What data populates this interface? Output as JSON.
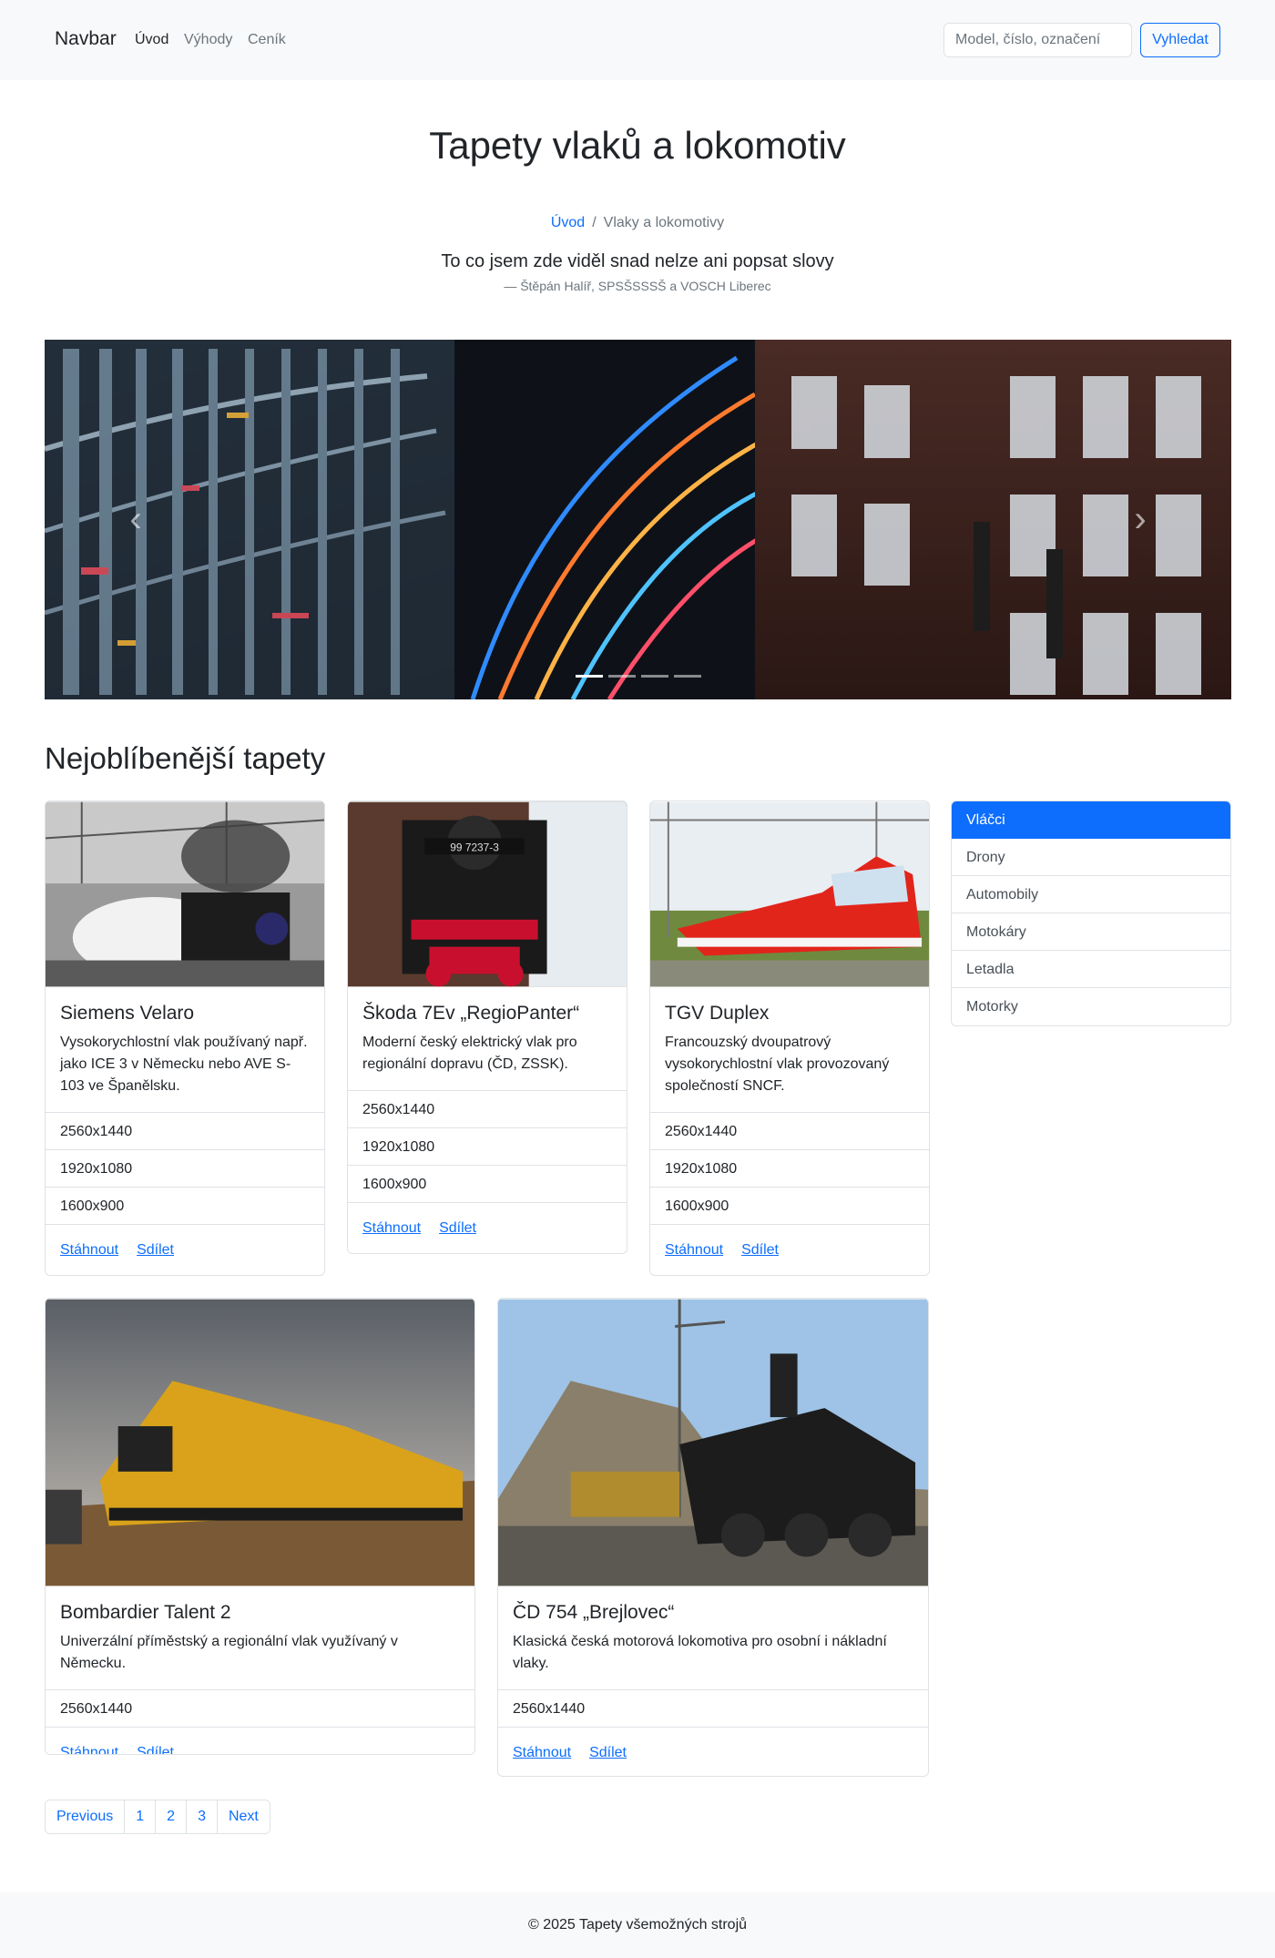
{
  "navbar": {
    "brand": "Navbar",
    "links": [
      "Úvod",
      "Výhody",
      "Ceník"
    ],
    "search": {
      "placeholder": "Model, číslo, označení",
      "button": "Vyhledat"
    }
  },
  "hero": {
    "title": "Tapety vlaků a lokomotiv",
    "breadcrumb": {
      "home": "Úvod",
      "separator": "/",
      "current": "Vlaky a lokomotivy"
    },
    "quote": "To co jsem zde viděl snad nelze ani popsat slovy",
    "quote_author": "— Štěpán Halíř, SPSŠSSSŠ a VOSCH Liberec"
  },
  "carousel": {
    "prev_icon": "chevron-left-icon",
    "next_icon": "chevron-right-icon",
    "slides_count": 4,
    "active_index": 0
  },
  "section": {
    "title": "Nejoblíbenější tapety"
  },
  "cards": [
    {
      "title": "Siemens Velaro",
      "text": "Vysokorychlostní vlak používaný např. jako ICE 3 v Německu nebo AVE S-103 ve Španělsku.",
      "resolutions": [
        "2560x1440",
        "1920x1080",
        "1600x900"
      ],
      "download": "Stáhnout",
      "share": "Sdílet"
    },
    {
      "title": "Škoda 7Ev „RegioPanter“",
      "text": "Moderní český elektrický vlak pro regionální dopravu (ČD, ZSSK).",
      "resolutions": [
        "2560x1440",
        "1920x1080",
        "1600x900"
      ],
      "download": "Stáhnout",
      "share": "Sdílet"
    },
    {
      "title": "TGV Duplex",
      "text": "Francouzský dvoupatrový vysokorychlostní vlak provozovaný společností SNCF.",
      "resolutions": [
        "2560x1440",
        "1920x1080",
        "1600x900"
      ],
      "download": "Stáhnout",
      "share": "Sdílet"
    },
    {
      "title": "Bombardier Talent 2",
      "text": "Univerzální příměstský a regionální vlak využívaný v Německu.",
      "resolutions": [
        "2560x1440"
      ],
      "download": "Stáhnout",
      "share": "Sdílet"
    },
    {
      "title": "ČD 754 „Brejlovec“",
      "text": "Klasická česká motorová lokomotiva pro osobní i nákladní vlaky.",
      "resolutions": [
        "2560x1440"
      ],
      "download": "Stáhnout",
      "share": "Sdílet"
    }
  ],
  "sidebar": {
    "items": [
      "Vláčci",
      "Drony",
      "Automobily",
      "Motokáry",
      "Letadla",
      "Motorky"
    ],
    "active_index": 0
  },
  "pagination": [
    "Previous",
    "1",
    "2",
    "3",
    "Next"
  ],
  "footer": {
    "text": "© 2025 Tapety všemožných strojů"
  },
  "colors": {
    "primary": "#0d6efd",
    "light_bg": "#f8f9fa",
    "border": "#dee2e6",
    "muted": "#6c757d"
  }
}
